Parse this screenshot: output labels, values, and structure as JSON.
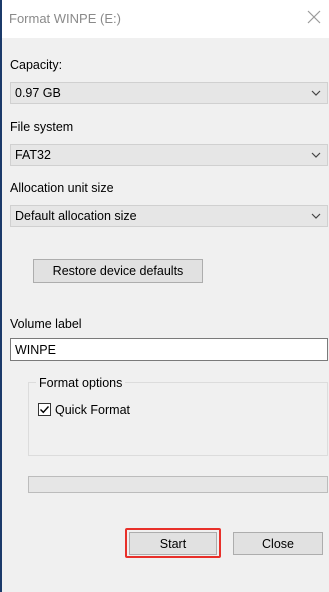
{
  "window": {
    "title": "Format WINPE (E:)"
  },
  "capacity": {
    "label": "Capacity:",
    "value": "0.97 GB"
  },
  "file_system": {
    "label": "File system",
    "value": "FAT32"
  },
  "allocation": {
    "label": "Allocation unit size",
    "value": "Default allocation size"
  },
  "restore_button": "Restore device defaults",
  "volume": {
    "label": "Volume label",
    "value": "WINPE"
  },
  "format_options": {
    "label": "Format options",
    "quick_format_label": "Quick Format",
    "quick_format_checked": true
  },
  "progress": {
    "value": 0
  },
  "buttons": {
    "start": "Start",
    "close": "Close"
  },
  "colors": {
    "highlight": "#e8302a",
    "window_border": "#1b3a6a"
  }
}
